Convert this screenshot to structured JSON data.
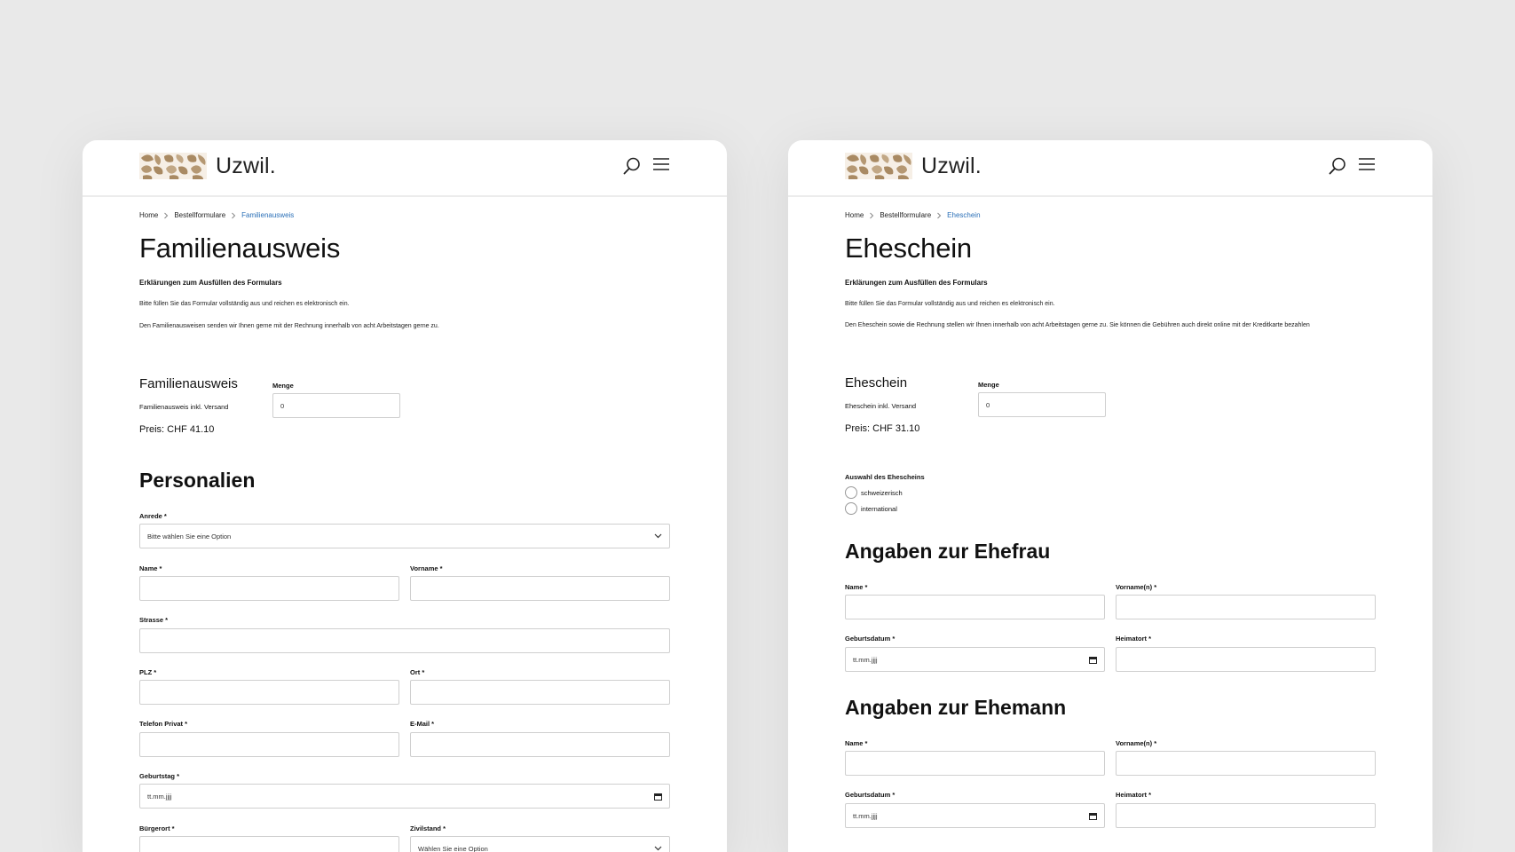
{
  "left": {
    "brand": "Uzwil.",
    "icons": {
      "search": "search-icon",
      "menu": "menu-icon"
    },
    "breadcrumb": [
      "Home",
      "Bestellformulare",
      "Familienausweis"
    ],
    "title": "Familienausweis",
    "intro_heading": "Erklärungen zum Ausfüllen des Formulars",
    "intro_p1": "Bitte füllen Sie das Formular vollständig aus und reichen es elektronisch ein.",
    "intro_p2": "Den Familienausweisen senden wir Ihnen gerne mit der Rechnung innerhalb von acht Arbeitstagen gerne zu.",
    "product": {
      "title": "Familienausweis",
      "sub": "Familienausweis inkl. Versand",
      "price": "Preis: CHF 41.10",
      "qty_label": "Menge",
      "qty_value": "0"
    },
    "section": "Personalien",
    "fields": {
      "anrede": {
        "label": "Anrede *",
        "value": "Bitte wählen Sie eine Option"
      },
      "name": {
        "label": "Name *"
      },
      "vorname": {
        "label": "Vorname *"
      },
      "strasse": {
        "label": "Strasse *"
      },
      "plz": {
        "label": "PLZ *"
      },
      "ort": {
        "label": "Ort *"
      },
      "telefon": {
        "label": "Telefon Privat *"
      },
      "email": {
        "label": "E-Mail *"
      },
      "geburtstag": {
        "label": "Geburtstag *",
        "value": "tt.mm.jjjj"
      },
      "buergerort": {
        "label": "Bürgerort *"
      },
      "zivilstand": {
        "label": "Zivilstand *",
        "value": "Wählen Sie eine Option"
      }
    }
  },
  "right": {
    "brand": "Uzwil.",
    "icons": {
      "search": "search-icon",
      "menu": "menu-icon"
    },
    "breadcrumb": [
      "Home",
      "Bestellformulare",
      "Eheschein"
    ],
    "title": "Eheschein",
    "intro_heading": "Erklärungen zum Ausfüllen des Formulars",
    "intro_p1": "Bitte füllen Sie das Formular vollständig aus und reichen es elektronisch ein.",
    "intro_p2": "Den Eheschein sowie die Rechnung stellen wir Ihnen innerhalb von acht Arbeitstagen gerne zu. Sie können die Gebühren auch direkt online mit der Kreditkarte bezahlen",
    "product": {
      "title": "Eheschein",
      "sub": "Eheschein inkl. Versand",
      "price": "Preis: CHF 31.10",
      "qty_label": "Menge",
      "qty_value": "0"
    },
    "choice": {
      "label": "Auswahl des Ehescheins",
      "options": [
        "schweizerisch",
        "international"
      ]
    },
    "wife": {
      "title": "Angaben zur Ehefrau",
      "name": "Name *",
      "vorname": "Vorname(n) *",
      "geburtsdatum": "Geburtsdatum *",
      "date_placeholder": "tt.mm.jjjj",
      "heimatort": "Heimatort *"
    },
    "husband": {
      "title": "Angaben zur Ehemann",
      "name": "Name *",
      "vorname": "Vorname(n) *",
      "geburtsdatum": "Geburtsdatum *",
      "date_placeholder": "tt.mm.jjjj",
      "heimatort": "Heimatort *"
    }
  }
}
